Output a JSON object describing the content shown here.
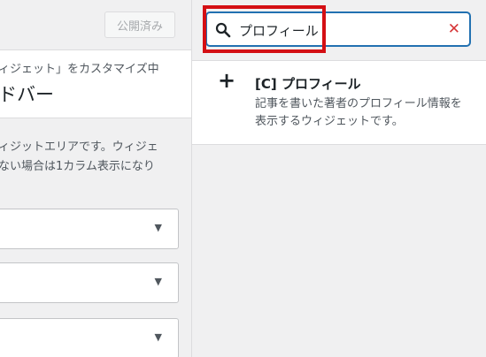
{
  "header": {
    "publish_label": "公開済み"
  },
  "section": {
    "breadcrumb": "ィジェット」をカスタマイズ中",
    "title": "ドバー",
    "description_lines": [
      "ィジットエリアです。ウィジェ",
      "ない場合は1カラム表示になり"
    ]
  },
  "selects": [
    {
      "arrow": "▼"
    },
    {
      "arrow": "▼"
    },
    {
      "arrow": "▼"
    }
  ],
  "search": {
    "value": "プロフィール",
    "clear_glyph": "✕"
  },
  "results": [
    {
      "add_glyph": "+",
      "name": "[C] プロフィール",
      "description_lines": [
        "記事を書いた著者のプロフィール情報を",
        "表示するウィジェットです。"
      ]
    }
  ],
  "colors": {
    "highlight": "#d40f14",
    "focus": "#2271b1",
    "clear": "#d63638"
  }
}
